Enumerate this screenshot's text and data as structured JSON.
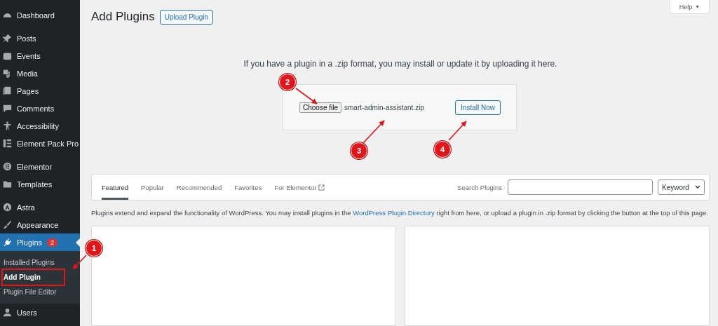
{
  "sidebar": {
    "groups": [
      [
        {
          "kind": "dashboard",
          "label": "Dashboard",
          "selected": false
        }
      ],
      [
        {
          "kind": "pin",
          "label": "Posts",
          "selected": false
        },
        {
          "kind": "calendar",
          "label": "Events",
          "selected": false
        },
        {
          "kind": "media",
          "label": "Media",
          "selected": false
        },
        {
          "kind": "pages",
          "label": "Pages",
          "selected": false
        },
        {
          "kind": "comment",
          "label": "Comments",
          "selected": false
        },
        {
          "kind": "person",
          "label": "Accessibility",
          "selected": false
        },
        {
          "kind": "epro",
          "label": "Element Pack Pro",
          "selected": false
        }
      ],
      [
        {
          "kind": "elementor",
          "label": "Elementor",
          "selected": false
        },
        {
          "kind": "folder",
          "label": "Templates",
          "selected": false
        }
      ],
      [
        {
          "kind": "astra",
          "label": "Astra",
          "selected": false
        },
        {
          "kind": "brush",
          "label": "Appearance",
          "selected": false
        },
        {
          "kind": "plug",
          "label": "Plugins",
          "selected": true,
          "badge": "2",
          "children": [
            {
              "label": "Installed Plugins",
              "selected": false,
              "highlighted": false
            },
            {
              "label": "Add Plugin",
              "selected": true,
              "highlighted": true
            },
            {
              "label": "Plugin File Editor",
              "selected": false,
              "highlighted": false
            }
          ]
        },
        {
          "kind": "user",
          "label": "Users",
          "selected": false
        }
      ]
    ]
  },
  "help_tab": {
    "label": "Help",
    "caret": "▼"
  },
  "page": {
    "title": "Add Plugins",
    "title_button": "Upload Plugin"
  },
  "upload": {
    "intro": "If you have a plugin in a .zip format, you may install or update it by uploading it here.",
    "choose_button": "Choose file",
    "file_name": "smart-admin-assistant.zip",
    "install_button": "Install Now"
  },
  "filter_bar": {
    "tabs": [
      {
        "label": "Featured",
        "selected": true,
        "external": false
      },
      {
        "label": "Popular",
        "selected": false,
        "external": false
      },
      {
        "label": "Recommended",
        "selected": false,
        "external": false
      },
      {
        "label": "Favorites",
        "selected": false,
        "external": false
      },
      {
        "label": "For Elementor",
        "selected": false,
        "external": true
      }
    ],
    "search_label": "Search Plugins",
    "search_type": "Keyword"
  },
  "description": {
    "before": "Plugins extend and expand the functionality of WordPress. You may install plugins in the ",
    "link": "WordPress Plugin Directory",
    "after": " right from here, or upload a plugin in .zip format by clicking the button at the top of this page."
  },
  "cards": [
    {
      "kind": "empty"
    },
    {
      "kind": "empty"
    }
  ],
  "annotations": [
    "1",
    "2",
    "3",
    "4"
  ]
}
